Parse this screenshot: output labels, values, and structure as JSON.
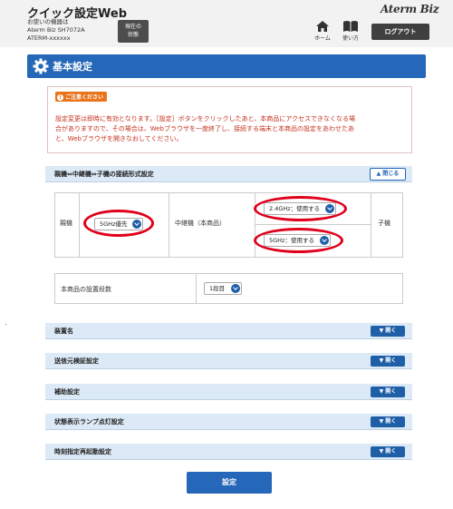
{
  "header": {
    "title": "クイック設定Web",
    "device_caption": "お使いの機器は",
    "device_model": "Aterm Biz SH7072A",
    "device_id": "ATERM-xxxxxx",
    "status_button": [
      "現在の",
      "状態"
    ],
    "brand": "Aterm Biz",
    "home_label": "ホーム",
    "help_label": "使い方",
    "logout_label": "ログアウト"
  },
  "page": {
    "title": "基本設定"
  },
  "notice": {
    "badge": "ご注意ください",
    "lines": [
      "設定変更は即時に有効となります。［設定］ボタンをクリックしたあと、本商品にアクセスできなくなる場",
      "合がありますので、その場合は、Webブラウザを一度終了し、接続する端末と本商品の設定をあわせたあ",
      "と、Webブラウザを開きなおしてください。"
    ]
  },
  "connection_section": {
    "title": "親機⇔中継機⇔子機の接続形式設定",
    "toggle_label": "閉じる",
    "parent_label": "親機",
    "parent_select": "5GHz優先",
    "repeater_label": "中継機（本商品）",
    "band24_select": "2.4GHz：使用する",
    "band5_select": "5GHz：使用する",
    "child_label": "子機",
    "stage_label": "本商品の設置段数",
    "stage_select": "1段目"
  },
  "collapsed_sections": [
    {
      "title": "装置名",
      "toggle_label": "開く"
    },
    {
      "title": "送信元検証設定",
      "toggle_label": "開く"
    },
    {
      "title": "補助設定",
      "toggle_label": "開く"
    },
    {
      "title": "状態表示ランプ点灯設定",
      "toggle_label": "開く"
    },
    {
      "title": "時刻指定再起動設定",
      "toggle_label": "開く"
    }
  ],
  "submit_label": "設定",
  "colors": {
    "accent": "#2567b8",
    "section_bg": "#dce9f6",
    "warning_text": "#c3321e",
    "highlight_ring": "#e0001b",
    "badge": "#e8731a"
  },
  "icons": [
    "home-icon",
    "book-icon",
    "gear-icon",
    "chevron-down-icon",
    "chevron-up-icon"
  ]
}
